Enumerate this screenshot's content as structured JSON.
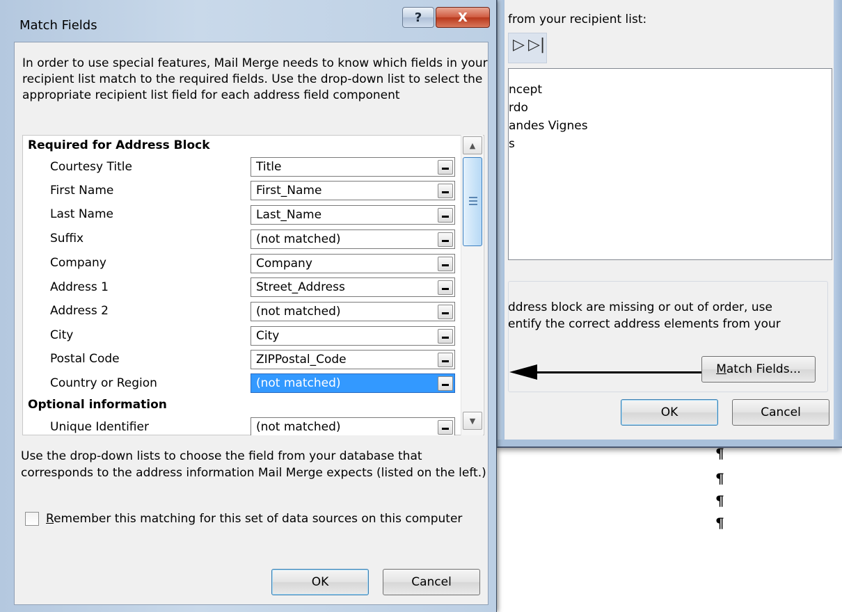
{
  "background": {
    "pilcrow": "¶"
  },
  "back_dialog": {
    "heading": "from your recipient list:",
    "nav": {
      "next_icon": "▷",
      "last_icon": "▷|"
    },
    "preview_lines": [
      "ncept",
      "rdo",
      "andes Vignes",
      "s"
    ],
    "info_lines": [
      "ddress block are missing or out of order, use",
      "entify the correct address elements from your"
    ],
    "match_fields_btn_pre": "",
    "match_fields_btn_underline": "M",
    "match_fields_btn_rest": "atch Fields...",
    "ok_label": "OK",
    "cancel_label": "Cancel"
  },
  "dialog": {
    "title": "Match Fields",
    "help_label": "?",
    "close_label": "X",
    "intro": "In order to use special features, Mail Merge needs to know which fields in your recipient list match to the required fields.  Use the drop-down list to select the appropriate recipient list field for each address field component",
    "section_required": "Required for Address Block",
    "section_optional": "Optional information",
    "fields": [
      {
        "label": "Courtesy Title",
        "value": "Title"
      },
      {
        "label": "First Name",
        "value": "First_Name"
      },
      {
        "label": "Last Name",
        "value": "Last_Name"
      },
      {
        "label": "Suffix",
        "value": "(not matched)"
      },
      {
        "label": "Company",
        "value": "Company"
      },
      {
        "label": "Address 1",
        "value": "Street_Address"
      },
      {
        "label": "Address 2",
        "value": "(not matched)"
      },
      {
        "label": "City",
        "value": "City"
      },
      {
        "label": "Postal Code",
        "value": "ZIPPostal_Code"
      },
      {
        "label": "Country or Region",
        "value": "(not matched)"
      }
    ],
    "optional_fields": [
      {
        "label": "Unique Identifier",
        "value": "(not matched)"
      }
    ],
    "bottom_text": "Use the drop-down lists to choose the field from your database that corresponds to the address information Mail Merge expects (listed on the left.)",
    "remember_underline": "R",
    "remember_rest": "emember this matching for this set of data sources on this computer",
    "ok_label": "OK",
    "cancel_label": "Cancel"
  }
}
